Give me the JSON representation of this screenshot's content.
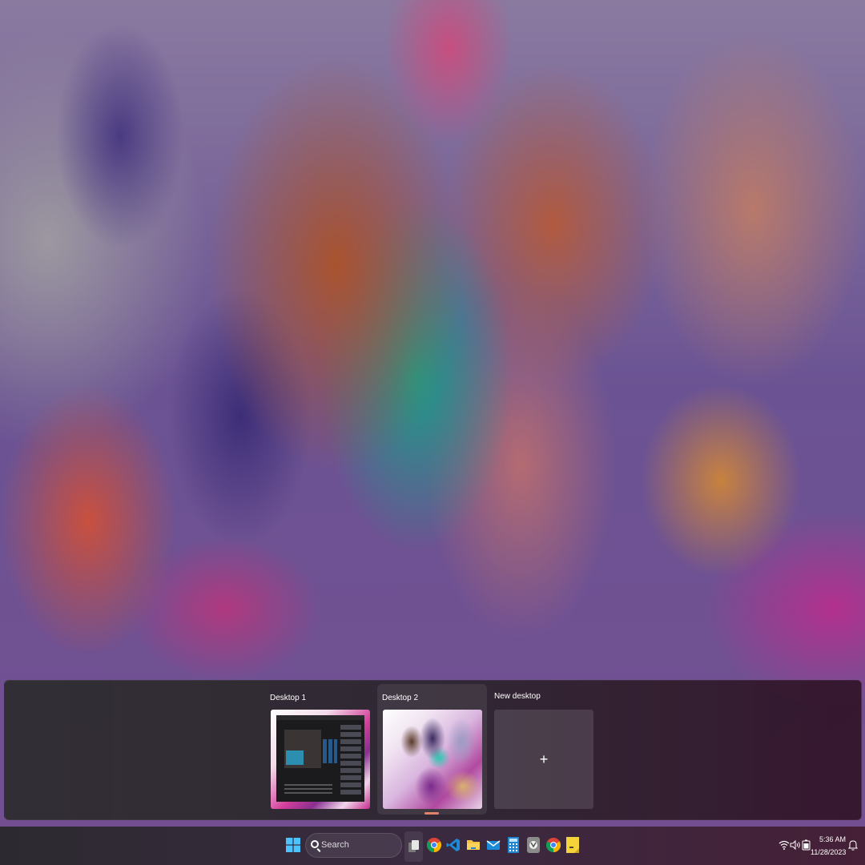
{
  "task_view": {
    "desktops": [
      {
        "label": "Desktop 1"
      },
      {
        "label": "Desktop 2"
      },
      {
        "label": "New desktop"
      }
    ],
    "new_desktop_symbol": "+"
  },
  "taskbar": {
    "search_placeholder": "Search",
    "icons": [
      "windows-start-icon",
      "search-icon",
      "task-view-icon",
      "chrome-icon",
      "vscode-icon",
      "file-explorer-icon",
      "mail-icon",
      "calculator-icon",
      "app-icon",
      "chrome-icon",
      "sticky-notes-icon"
    ],
    "tray": {
      "time": "5:36 AM",
      "date": "11/28/2023",
      "icons": [
        "wifi-icon",
        "volume-icon",
        "battery-icon",
        "notification-icon"
      ]
    }
  },
  "colors": {
    "active_indicator": "#e0836a",
    "windows_blue": "#4cc2ff"
  }
}
